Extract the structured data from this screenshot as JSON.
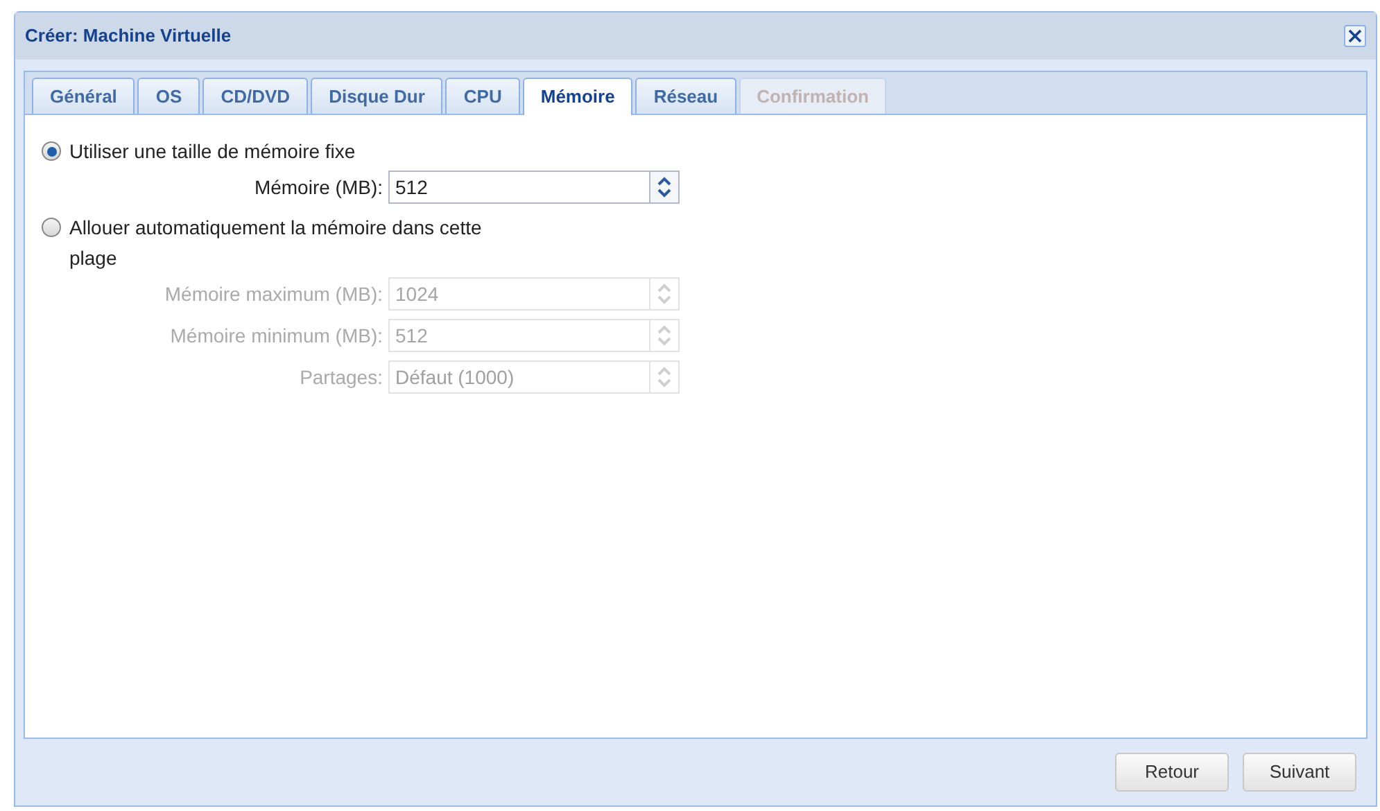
{
  "window": {
    "title": "Créer: Machine Virtuelle"
  },
  "tabs": [
    {
      "label": "Général",
      "selected": false,
      "disabled": false
    },
    {
      "label": "OS",
      "selected": false,
      "disabled": false
    },
    {
      "label": "CD/DVD",
      "selected": false,
      "disabled": false
    },
    {
      "label": "Disque Dur",
      "selected": false,
      "disabled": false
    },
    {
      "label": "CPU",
      "selected": false,
      "disabled": false
    },
    {
      "label": "Mémoire",
      "selected": true,
      "disabled": false
    },
    {
      "label": "Réseau",
      "selected": false,
      "disabled": false
    },
    {
      "label": "Confirmation",
      "selected": false,
      "disabled": true
    }
  ],
  "memory_modes": [
    {
      "label": "Utiliser une taille de mémoire fixe",
      "selected": true,
      "fields": [
        {
          "label": "Mémoire (MB):",
          "value": "512",
          "disabled": false
        }
      ]
    },
    {
      "label": "Allouer automatiquement la mémoire dans cette plage",
      "selected": false,
      "fields": [
        {
          "label": "Mémoire maximum (MB):",
          "value": "1024",
          "disabled": true
        },
        {
          "label": "Mémoire minimum (MB):",
          "value": "512",
          "disabled": true
        },
        {
          "label": "Partages:",
          "placeholder": "Défaut (1000)",
          "disabled": true
        }
      ]
    }
  ],
  "buttons": [
    "Retour",
    "Suivant"
  ]
}
